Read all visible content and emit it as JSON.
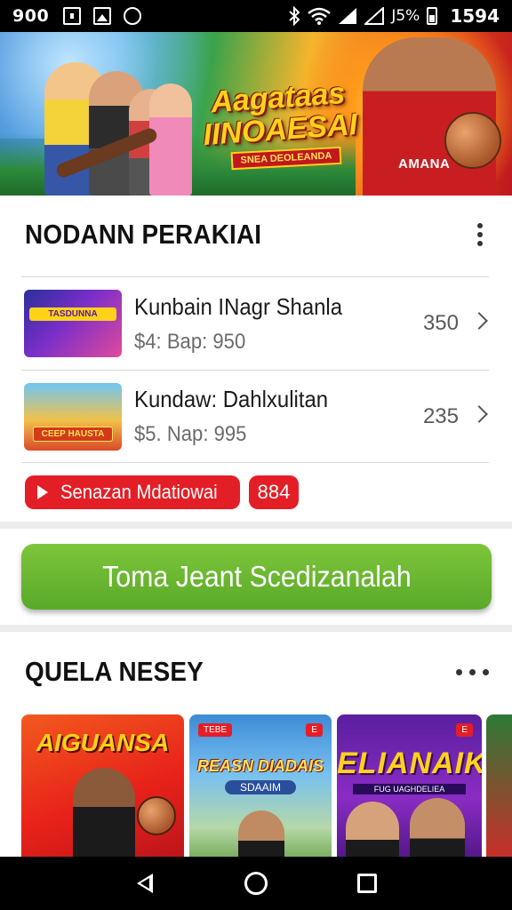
{
  "status_bar": {
    "time": "900",
    "battery": "J5%",
    "clock_right": "1594"
  },
  "banner": {
    "title": "Aagataas IINOAESAI",
    "subtitle": "SNEA DEOLEANDA",
    "player_shirt": "AMANA"
  },
  "section1": {
    "title": "NODANN PERAKIAI",
    "items": [
      {
        "title": "Kunbain INagr Shanla",
        "subtitle": "$4: Bap: 950",
        "count": "350",
        "thumb_caption": "TASDUNNA"
      },
      {
        "title": "Kundaw: Dahlxulitan",
        "subtitle": "$5. Nap: 995",
        "count": "235",
        "thumb_caption": "CEEP HAUSTA"
      }
    ],
    "badge_label": "Senazan Mdatiowai",
    "badge_count": "884"
  },
  "cta": {
    "label": "Toma Jeant Scedizanalah"
  },
  "section2": {
    "title": "QUELA NESEY",
    "cards": [
      {
        "title": "AIGUANSA"
      },
      {
        "title": "REASN DIADAIS",
        "subtitle": "SDAAIM",
        "tag_left": "TEBE",
        "tag_right": "E"
      },
      {
        "title": "ELIANAIK",
        "subtitle": "FUG UAGHDELIEA",
        "tag_left": "",
        "tag_right": "E"
      }
    ]
  },
  "nav_bar": {
    "back": "back-icon",
    "home": "home-icon",
    "recents": "recents-icon"
  }
}
